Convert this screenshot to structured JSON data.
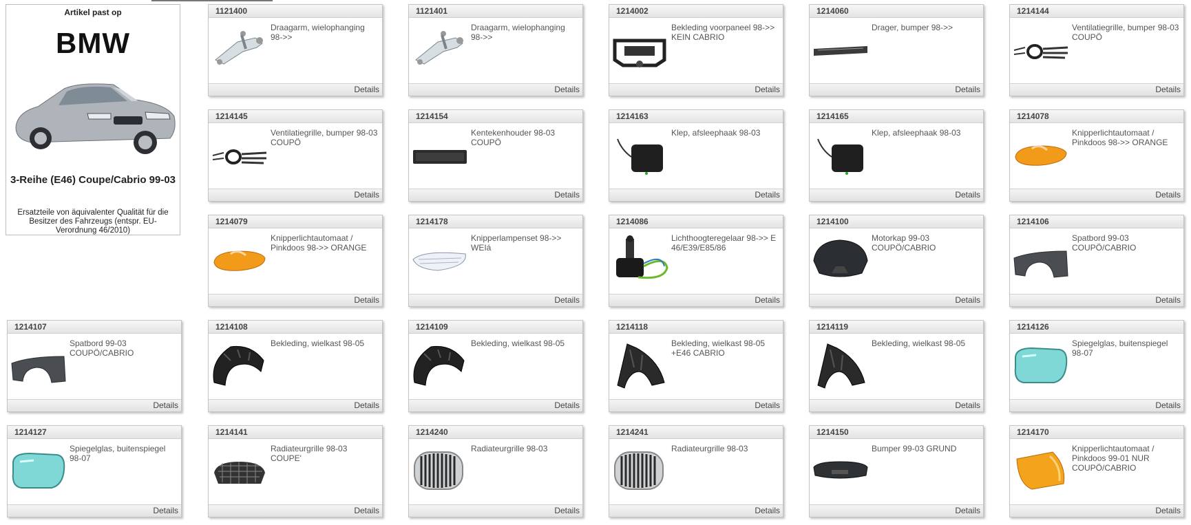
{
  "info": {
    "fit_label": "Artikel past op",
    "brand": "BMW",
    "model": "3-Reihe (E46) Coupe/Cabrio 99-03",
    "note": "Ersatzteile von äquivalenter Qualität für die Besitzer des Fahrzeugs (entspr. EU-Verordnung 46/2010)"
  },
  "details_label": "Details",
  "cards": [
    {
      "num": "1121400",
      "desc": "Draagarm, wielophanging 98->>",
      "icon": "control-arm"
    },
    {
      "num": "1121401",
      "desc": "Draagarm, wielophanging 98->>",
      "icon": "control-arm"
    },
    {
      "num": "1214002",
      "desc": "Bekleding voorpaneel 98->> KEIN CABRIO",
      "icon": "front-panel"
    },
    {
      "num": "1214060",
      "desc": "Drager, bumper 98->>",
      "icon": "bumper-carrier"
    },
    {
      "num": "1214144",
      "desc": "Ventilatiegrille, bumper 98-03 COUPÖ",
      "icon": "vent-grille"
    },
    {
      "num": "1214145",
      "desc": "Ventilatiegrille, bumper 98-03 COUPÖ",
      "icon": "vent-grille"
    },
    {
      "num": "1214154",
      "desc": "Kentekenhouder 98-03 COUPÖ",
      "icon": "plate-holder"
    },
    {
      "num": "1214163",
      "desc": "Klep, afsleephaak 98-03",
      "icon": "tow-cover"
    },
    {
      "num": "1214165",
      "desc": "Klep, afsleephaak 98-03",
      "icon": "tow-cover"
    },
    {
      "num": "1214078",
      "desc": "Knipperlichtautomaat / Pinkdoos 98->> ORANGE",
      "icon": "orange-lamp"
    },
    {
      "num": "1214079",
      "desc": "Knipperlichtautomaat / Pinkdoos 98->> ORANGE",
      "icon": "orange-lamp"
    },
    {
      "num": "1214178",
      "desc": "Knipperlampenset 98->> WEIá",
      "icon": "clear-lamp"
    },
    {
      "num": "1214086",
      "desc": "Lichthoogteregelaar 98->> E 46/E39/E85/86",
      "icon": "actuator"
    },
    {
      "num": "1214100",
      "desc": "Motorkap 99-03 COUPÖ/CABRIO",
      "icon": "hood"
    },
    {
      "num": "1214106",
      "desc": "Spatbord 99-03 COUPÖ/CABRIO",
      "icon": "fender"
    },
    {
      "num": "1214107",
      "desc": "Spatbord 99-03 COUPÖ/CABRIO",
      "icon": "fender"
    },
    {
      "num": "1214108",
      "desc": "Bekleding, wielkast 98-05",
      "icon": "wheel-liner"
    },
    {
      "num": "1214109",
      "desc": "Bekleding, wielkast 98-05",
      "icon": "wheel-liner"
    },
    {
      "num": "1214118",
      "desc": "Bekleding, wielkast 98-05 +E46 CABRIO",
      "icon": "wheel-liner-tall"
    },
    {
      "num": "1214119",
      "desc": "Bekleding, wielkast 98-05",
      "icon": "wheel-liner-tall"
    },
    {
      "num": "1214126",
      "desc": "Spiegelglas, buitenspiegel 98-07",
      "icon": "mirror-glass"
    },
    {
      "num": "1214127",
      "desc": "Spiegelglas, buitenspiegel 98-07",
      "icon": "mirror-glass"
    },
    {
      "num": "1214141",
      "desc": "Radiateurgrille 98-03 COUPE'",
      "icon": "mesh-grille"
    },
    {
      "num": "1214240",
      "desc": "Radiateurgrille 98-03",
      "icon": "kidney-grille"
    },
    {
      "num": "1214241",
      "desc": "Radiateurgrille 98-03",
      "icon": "kidney-grille"
    },
    {
      "num": "1214150",
      "desc": "Bumper 99-03 GRUND",
      "icon": "bumper"
    },
    {
      "num": "1214170",
      "desc": "Knipperlichtautomaat / Pinkdoos 99-01 NUR COUPÖ/CABRIO",
      "icon": "corner-lamp"
    }
  ]
}
